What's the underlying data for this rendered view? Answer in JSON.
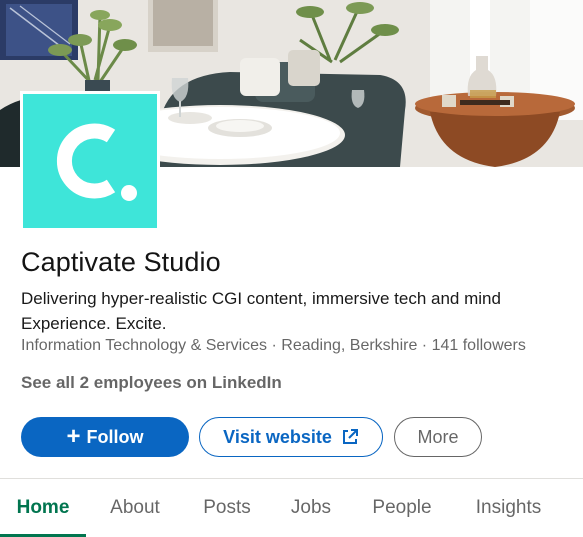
{
  "company": {
    "name": "Captivate Studio",
    "tagline": "Delivering hyper-realistic CGI content, immersive tech and mind\nExperience. Excite.",
    "industry": "Information Technology & Services",
    "location": "Reading, Berkshire",
    "followers": "141 followers",
    "separator": " · ",
    "employees_link": "See all 2 employees on LinkedIn",
    "logo_icon": "captivate-c-logo",
    "brand_color": "#3ee5d9"
  },
  "actions": {
    "follow_label": "Follow",
    "follow_icon": "plus-icon",
    "website_label": "Visit website",
    "website_icon": "external-link-icon",
    "more_label": "More",
    "primary_color": "#0a66c2"
  },
  "tabs": [
    {
      "label": "Home",
      "active": true
    },
    {
      "label": "About",
      "active": false
    },
    {
      "label": "Posts",
      "active": false
    },
    {
      "label": "Jobs",
      "active": false
    },
    {
      "label": "People",
      "active": false
    },
    {
      "label": "Insights",
      "active": false
    }
  ],
  "tab_accent": "#01754f"
}
